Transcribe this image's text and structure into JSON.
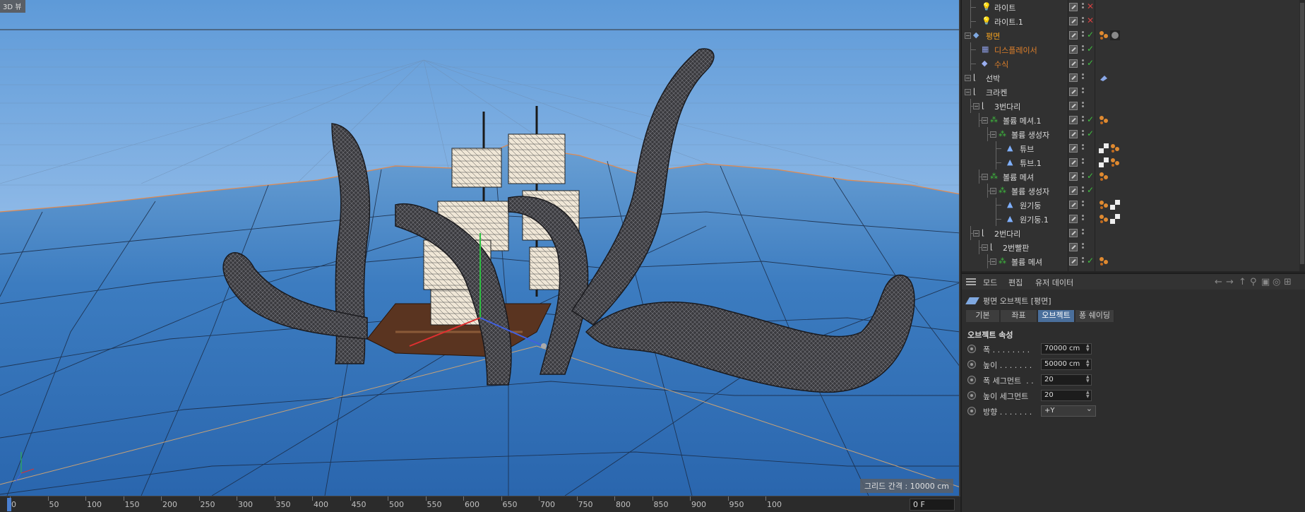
{
  "viewport": {
    "title": "3D 뷰",
    "grid_label": "그리드 간격 : 10000 cm"
  },
  "timeline": {
    "ticks": [
      "0",
      "50",
      "100",
      "150",
      "200",
      "250",
      "300",
      "350",
      "400",
      "450",
      "500",
      "550",
      "600",
      "650",
      "700",
      "750",
      "800",
      "850",
      "900",
      "950",
      "100"
    ],
    "frame_value": "0 F"
  },
  "object_manager": {
    "objects": [
      {
        "name": "라이트",
        "color": "#d8d8d8",
        "icon": "light-icon",
        "state": "x",
        "tags": []
      },
      {
        "name": "라이트.1",
        "color": "#d8d8d8",
        "icon": "light-icon",
        "state": "x",
        "tags": []
      },
      {
        "name": "평면",
        "color": "#f0a020",
        "icon": "plane-icon",
        "state": "check",
        "tags": [
          "material-tag-icon",
          "texture-tag-icon"
        ]
      },
      {
        "name": "디스플레이서",
        "color": "#e0802a",
        "icon": "displacer-icon",
        "state": "check",
        "tags": []
      },
      {
        "name": "수식",
        "color": "#e0802a",
        "icon": "formula-icon",
        "state": "check",
        "tags": []
      },
      {
        "name": "선박",
        "color": "#d8d8d8",
        "icon": "null-icon",
        "state": "none",
        "tags": [
          "selection-tag-icon"
        ]
      },
      {
        "name": "크라켄",
        "color": "#d8d8d8",
        "icon": "null-icon",
        "state": "none",
        "tags": []
      },
      {
        "name": "3번다리",
        "color": "#d8d8d8",
        "icon": "null-icon",
        "state": "none",
        "tags": []
      },
      {
        "name": "볼륨 메셔.1",
        "color": "#d8d8d8",
        "icon": "volume-icon",
        "state": "check",
        "tags": [
          "material-tag-icon"
        ]
      },
      {
        "name": "볼륨 생성자",
        "color": "#d8d8d8",
        "icon": "volume-icon",
        "state": "check",
        "tags": []
      },
      {
        "name": "튜브",
        "color": "#d8d8d8",
        "icon": "primitive-icon",
        "state": "none",
        "tags": [
          "checker-tag-icon",
          "material-tag-icon"
        ]
      },
      {
        "name": "튜브.1",
        "color": "#d8d8d8",
        "icon": "primitive-icon",
        "state": "none",
        "tags": [
          "checker-tag-icon",
          "material-tag-icon"
        ]
      },
      {
        "name": "볼륨 메셔",
        "color": "#d8d8d8",
        "icon": "volume-icon",
        "state": "check",
        "tags": [
          "material-tag-icon"
        ]
      },
      {
        "name": "볼륨 생성자",
        "color": "#d8d8d8",
        "icon": "volume-icon",
        "state": "check",
        "tags": []
      },
      {
        "name": "원기둥",
        "color": "#d8d8d8",
        "icon": "primitive-icon",
        "state": "none",
        "tags": [
          "material-tag-icon",
          "checker-tag-icon"
        ]
      },
      {
        "name": "원기둥.1",
        "color": "#d8d8d8",
        "icon": "primitive-icon",
        "state": "none",
        "tags": [
          "material-tag-icon",
          "checker-tag-icon"
        ]
      },
      {
        "name": "2번다리",
        "color": "#d8d8d8",
        "icon": "null-icon",
        "state": "none",
        "tags": []
      },
      {
        "name": "2번빨판",
        "color": "#d8d8d8",
        "icon": "null-icon",
        "state": "none",
        "tags": []
      },
      {
        "name": "볼륨 메셔",
        "color": "#d8d8d8",
        "icon": "volume-icon",
        "state": "check",
        "tags": [
          "material-tag-icon"
        ]
      }
    ]
  },
  "attribute_manager": {
    "menu": [
      "모드",
      "편집",
      "유저 데이터"
    ],
    "object_title": "평면 오브젝트 [평면]",
    "tabs": [
      "기본",
      "좌표",
      "오브젝트",
      "퐁 쉐이딩"
    ],
    "active_tab": "오브젝트",
    "section_title": "오브젝트 속성",
    "properties": [
      {
        "label": "폭 . . . . . . . . ",
        "value": "70000 cm",
        "type": "number"
      },
      {
        "label": "높이 . . . . . . . ",
        "value": "50000 cm",
        "type": "number"
      },
      {
        "label": "폭 세그먼트  . .",
        "value": "20",
        "type": "number"
      },
      {
        "label": "높이 세그먼트 ",
        "value": "20",
        "type": "number"
      },
      {
        "label": "방향 . . . . . . . ",
        "value": "+Y",
        "type": "select"
      }
    ]
  },
  "colors": {
    "accent": "#4a6f9c",
    "check": "#3fbf3f",
    "x": "#d04040",
    "sky_top": "#a8c8ec",
    "water": "#3f7fc0"
  }
}
